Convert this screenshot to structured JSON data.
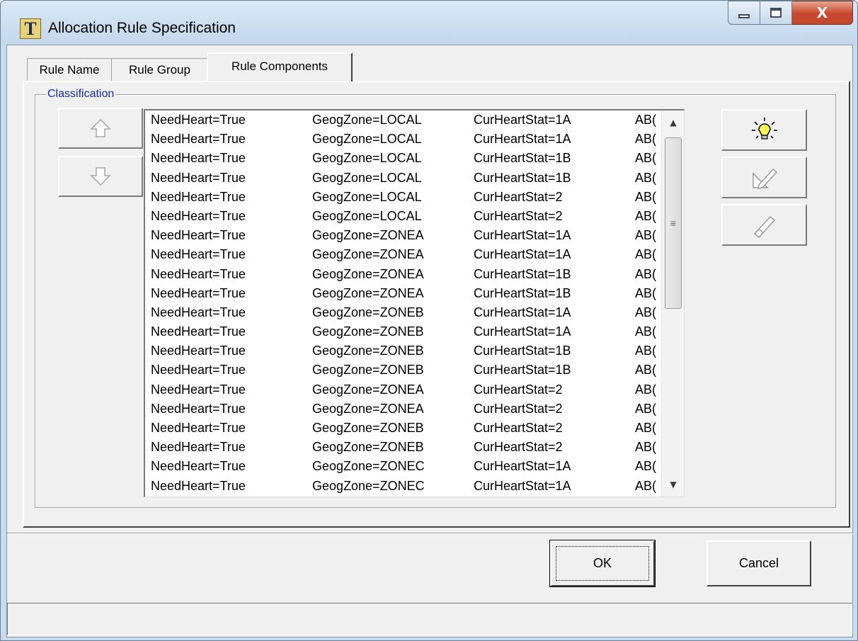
{
  "window": {
    "app_icon_letter": "T",
    "title": "Allocation Rule Specification",
    "close_glyph": "X"
  },
  "tabs": [
    {
      "label": "Rule Name",
      "active": false
    },
    {
      "label": "Rule Group",
      "active": false
    },
    {
      "label": "Rule Components",
      "active": true
    }
  ],
  "classification": {
    "label": "Classification",
    "move_up_icon": "arrow-up-icon",
    "move_down_icon": "arrow-down-icon",
    "rows": [
      [
        "NeedHeart=True",
        "GeogZone=LOCAL",
        "CurHeartStat=1A",
        "AB("
      ],
      [
        "NeedHeart=True",
        "GeogZone=LOCAL",
        "CurHeartStat=1A",
        "AB("
      ],
      [
        "NeedHeart=True",
        "GeogZone=LOCAL",
        "CurHeartStat=1B",
        "AB("
      ],
      [
        "NeedHeart=True",
        "GeogZone=LOCAL",
        "CurHeartStat=1B",
        "AB("
      ],
      [
        "NeedHeart=True",
        "GeogZone=LOCAL",
        "CurHeartStat=2",
        "AB("
      ],
      [
        "NeedHeart=True",
        "GeogZone=LOCAL",
        "CurHeartStat=2",
        "AB("
      ],
      [
        "NeedHeart=True",
        "GeogZone=ZONEA",
        "CurHeartStat=1A",
        "AB("
      ],
      [
        "NeedHeart=True",
        "GeogZone=ZONEA",
        "CurHeartStat=1A",
        "AB("
      ],
      [
        "NeedHeart=True",
        "GeogZone=ZONEA",
        "CurHeartStat=1B",
        "AB("
      ],
      [
        "NeedHeart=True",
        "GeogZone=ZONEA",
        "CurHeartStat=1B",
        "AB("
      ],
      [
        "NeedHeart=True",
        "GeogZone=ZONEB",
        "CurHeartStat=1A",
        "AB("
      ],
      [
        "NeedHeart=True",
        "GeogZone=ZONEB",
        "CurHeartStat=1A",
        "AB("
      ],
      [
        "NeedHeart=True",
        "GeogZone=ZONEB",
        "CurHeartStat=1B",
        "AB("
      ],
      [
        "NeedHeart=True",
        "GeogZone=ZONEB",
        "CurHeartStat=1B",
        "AB("
      ],
      [
        "NeedHeart=True",
        "GeogZone=ZONEA",
        "CurHeartStat=2",
        "AB("
      ],
      [
        "NeedHeart=True",
        "GeogZone=ZONEA",
        "CurHeartStat=2",
        "AB("
      ],
      [
        "NeedHeart=True",
        "GeogZone=ZONEB",
        "CurHeartStat=2",
        "AB("
      ],
      [
        "NeedHeart=True",
        "GeogZone=ZONEB",
        "CurHeartStat=2",
        "AB("
      ],
      [
        "NeedHeart=True",
        "GeogZone=ZONEC",
        "CurHeartStat=1A",
        "AB("
      ],
      [
        "NeedHeart=True",
        "GeogZone=ZONEC",
        "CurHeartStat=1A",
        "AB("
      ]
    ],
    "scroll": {
      "up_glyph": "▲",
      "down_glyph": "▼",
      "thumb_grip": "≡"
    }
  },
  "side_tools": {
    "new_icon": "lightbulb-icon",
    "edit_icon": "pencil-ruler-icon",
    "delete_icon": "eraser-icon"
  },
  "footer": {
    "ok_label": "OK",
    "cancel_label": "Cancel"
  },
  "colors": {
    "group_label": "#1a2aa8",
    "close_button": "#c9452b",
    "bulb": "#fff45a"
  }
}
